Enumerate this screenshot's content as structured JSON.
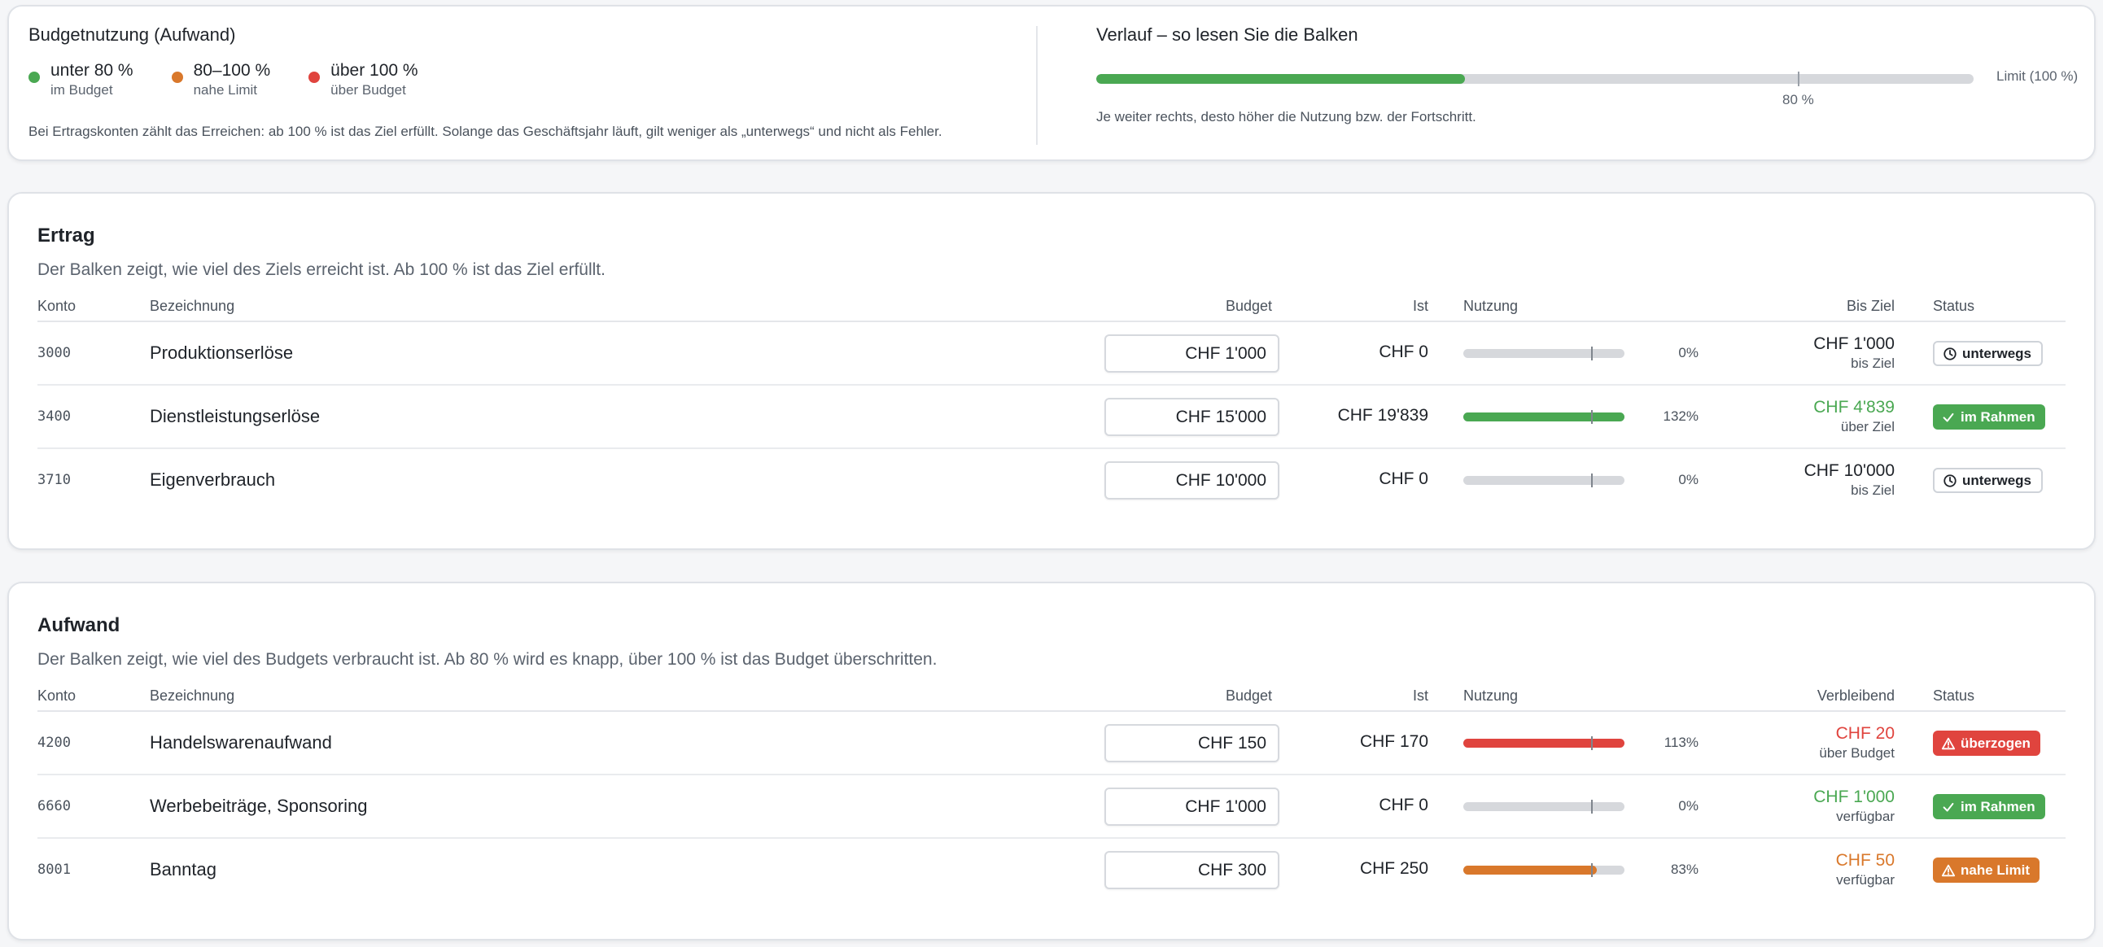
{
  "legend": {
    "title": "Budgetnutzung (Aufwand)",
    "items": [
      {
        "label": "unter 80 %",
        "sub": "im Budget",
        "color": "#4aa852"
      },
      {
        "label": "80–100 %",
        "sub": "nahe Limit",
        "color": "#d9782b"
      },
      {
        "label": "über 100 %",
        "sub": "über Budget",
        "color": "#e0443e"
      }
    ],
    "note": "Bei Ertragskonten zählt das Erreichen: ab 100 % ist das Ziel erfüllt. Solange das Geschäftsjahr läuft, gilt weniger als „unterwegs“ und nicht als Fehler."
  },
  "howto": {
    "title": "Verlauf – so lesen Sie die Balken",
    "demo_progress": 0.42,
    "threshold": 0.8,
    "limit_label": "Limit (100 %)",
    "threshold_label": "80 %",
    "note": "Je weiter rechts, desto höher die Nutzung bzw. der Fortschritt."
  },
  "columns": {
    "konto": "Konto",
    "bezeichnung": "Bezeichnung",
    "budget": "Budget",
    "ist": "Ist",
    "nutzung": "Nutzung",
    "status": "Status"
  },
  "ertrag": {
    "title": "Ertrag",
    "description": "Der Balken zeigt, wie viel des Ziels erreicht ist. Ab 100 % ist das Ziel erfüllt.",
    "rest_header": "Bis Ziel",
    "rows": [
      {
        "konto": "3000",
        "bezeichnung": "Produktionserlöse",
        "budget": "CHF 1'000",
        "ist": "CHF 0",
        "usage": 0,
        "pct": "0%",
        "rest": "CHF 1'000",
        "rest_sub": "bis Ziel",
        "rest_color": "#1f2329",
        "status": "unterwegs",
        "status_type": "unterwegs"
      },
      {
        "konto": "3400",
        "bezeichnung": "Dienstleistungserlöse",
        "budget": "CHF 15'000",
        "ist": "CHF 19'839",
        "usage": 1.32,
        "pct": "132%",
        "rest": "CHF 4'839",
        "rest_sub": "über Ziel",
        "rest_color": "#4aa852",
        "status": "im Rahmen",
        "status_type": "ok"
      },
      {
        "konto": "3710",
        "bezeichnung": "Eigenverbrauch",
        "budget": "CHF 10'000",
        "ist": "CHF 0",
        "usage": 0,
        "pct": "0%",
        "rest": "CHF 10'000",
        "rest_sub": "bis Ziel",
        "rest_color": "#1f2329",
        "status": "unterwegs",
        "status_type": "unterwegs"
      }
    ]
  },
  "aufwand": {
    "title": "Aufwand",
    "description": "Der Balken zeigt, wie viel des Budgets verbraucht ist. Ab 80 % wird es knapp, über 100 % ist das Budget überschritten.",
    "rest_header": "Verbleibend",
    "rows": [
      {
        "konto": "4200",
        "bezeichnung": "Handelswarenaufwand",
        "budget": "CHF 150",
        "ist": "CHF 170",
        "usage": 1.13,
        "pct": "113%",
        "rest": "CHF 20",
        "rest_sub": "über Budget",
        "rest_color": "#e0443e",
        "status": "überzogen",
        "status_type": "over"
      },
      {
        "konto": "6660",
        "bezeichnung": "Werbebeiträge, Sponsoring",
        "budget": "CHF 1'000",
        "ist": "CHF 0",
        "usage": 0,
        "pct": "0%",
        "rest": "CHF 1'000",
        "rest_sub": "verfügbar",
        "rest_color": "#4aa852",
        "status": "im Rahmen",
        "status_type": "ok"
      },
      {
        "konto": "8001",
        "bezeichnung": "Banntag",
        "budget": "CHF 300",
        "ist": "CHF 250",
        "usage": 0.83,
        "pct": "83%",
        "rest": "CHF 50",
        "rest_sub": "verfügbar",
        "rest_color": "#d9782b",
        "status": "nahe Limit",
        "status_type": "near"
      }
    ]
  },
  "colors": {
    "ok": "#4aa852",
    "near": "#d9782b",
    "over": "#e0443e",
    "track": "#d6d8dc"
  }
}
